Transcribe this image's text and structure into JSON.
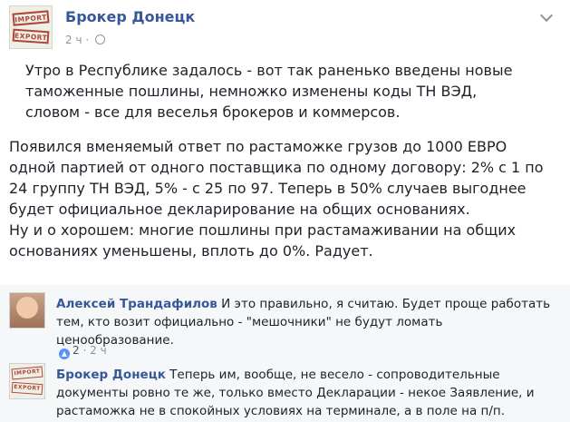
{
  "post": {
    "author": "Брокер Донецк",
    "time": "2 ч",
    "paragraph1": "Утро в Республике задалось - вот так раненько введены новые таможенные пошлины, немножко изменены коды ТН ВЭД, словом - все для веселья брокеров и коммерсов.",
    "paragraph2": "Появился вменяемый ответ по растаможке грузов до 1000 ЕВРО одной партией от одного поставщика по одному договору: 2% с 1 по 24 группу ТН ВЭД, 5% - с 25 по 97. Теперь в 50% случаев выгоднее будет официальное декларирование на общих основаниях.",
    "paragraph3": "Ну и о хорошем: многие пошлины при растамаживании на общих основаниях уменьшены, вплоть до 0%. Радует.",
    "avatar_stamp_top": "IMPORT",
    "avatar_stamp_bottom": "EXPORT"
  },
  "comments": [
    {
      "author": "Алексей Трандафилов",
      "text": "И это правильно, я считаю. Будет проще работать тем, кто возит официально - \"мешочники\" не будут ломать ценообразование.",
      "likes": "2",
      "time": "2 ч",
      "separator": "·"
    },
    {
      "author": "Брокер Донецк",
      "text": "Теперь им, вообще, не весело - сопроводительные документы ровно те же, только вместо Декларации - некое Заявление, и растаможка не в спокойных условиях на терминале, а в поле на п/п.",
      "avatar_stamp_top": "IMPORT",
      "avatar_stamp_bottom": "EXPORT"
    }
  ],
  "icons": {
    "globe": "globe-icon",
    "chevron": "chevron-down-icon",
    "like": "like-icon"
  },
  "colors": {
    "link": "#365899",
    "meta": "#90949c",
    "stamp": "#b0453a"
  }
}
